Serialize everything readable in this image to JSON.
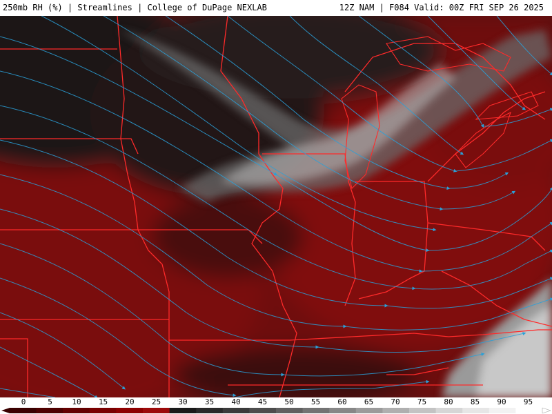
{
  "header": {
    "title_left": "250mb RH (%) | Streamlines | College of DuPage NEXLAB",
    "title_right": "12Z NAM | F084 Valid: 00Z FRI SEP 26 2025"
  },
  "legend": {
    "ticks": [
      "0",
      "5",
      "10",
      "15",
      "20",
      "25",
      "30",
      "35",
      "40",
      "45",
      "50",
      "55",
      "60",
      "65",
      "70",
      "75",
      "80",
      "85",
      "90",
      "95"
    ],
    "colors": [
      "#3a0000",
      "#4e0000",
      "#640000",
      "#7a0000",
      "#8e0000",
      "#9c0a0a",
      "#1a1a1a",
      "#2a2a2a",
      "#3b3b3b",
      "#4d4d4d",
      "#606060",
      "#737373",
      "#878787",
      "#9b9b9b",
      "#afafaf",
      "#c3c3c3",
      "#d6d6d6",
      "#e6e6e6",
      "#f2f2f2",
      "#ffffff"
    ]
  },
  "map": {
    "state_border_color": "#ff2a2a",
    "streamline_color": "#2aa0d8"
  }
}
